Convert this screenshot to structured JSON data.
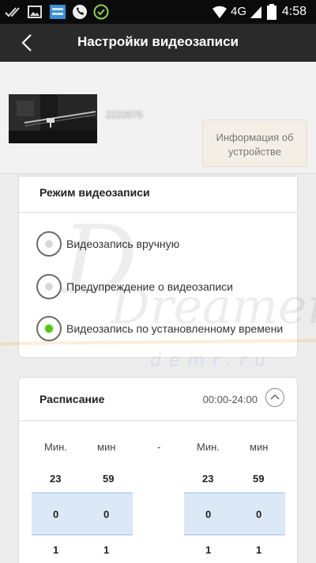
{
  "status_bar": {
    "network": "4G",
    "time": "4:58"
  },
  "app_bar": {
    "title": "Настройки видеозаписи"
  },
  "device": {
    "name": "2222075",
    "info_button": "Информация об устройстве"
  },
  "recording_mode": {
    "title": "Режим видеозаписи",
    "options": [
      {
        "label": "Видеозапись вручную",
        "selected": false
      },
      {
        "label": "Предупреждение о видеозаписи",
        "selected": false
      },
      {
        "label": "Видеозапись по установленному времени",
        "selected": true
      }
    ],
    "selected_color": "#52c41a"
  },
  "schedule": {
    "title": "Расписание",
    "range": "00:00-24:00",
    "picker": {
      "start": {
        "head_hour": "Мин.",
        "head_min": "мин",
        "values_hour": [
          "23",
          "0",
          "1"
        ],
        "values_min": [
          "59",
          "0",
          "1"
        ]
      },
      "separator": "-",
      "end": {
        "head_hour": "Мин.",
        "head_min": "мин",
        "values_hour": [
          "23",
          "0",
          "1"
        ],
        "values_min": [
          "59",
          "0",
          "1"
        ]
      }
    }
  },
  "watermark": {
    "brand": "Dreamers",
    "site": "demr.ru"
  }
}
